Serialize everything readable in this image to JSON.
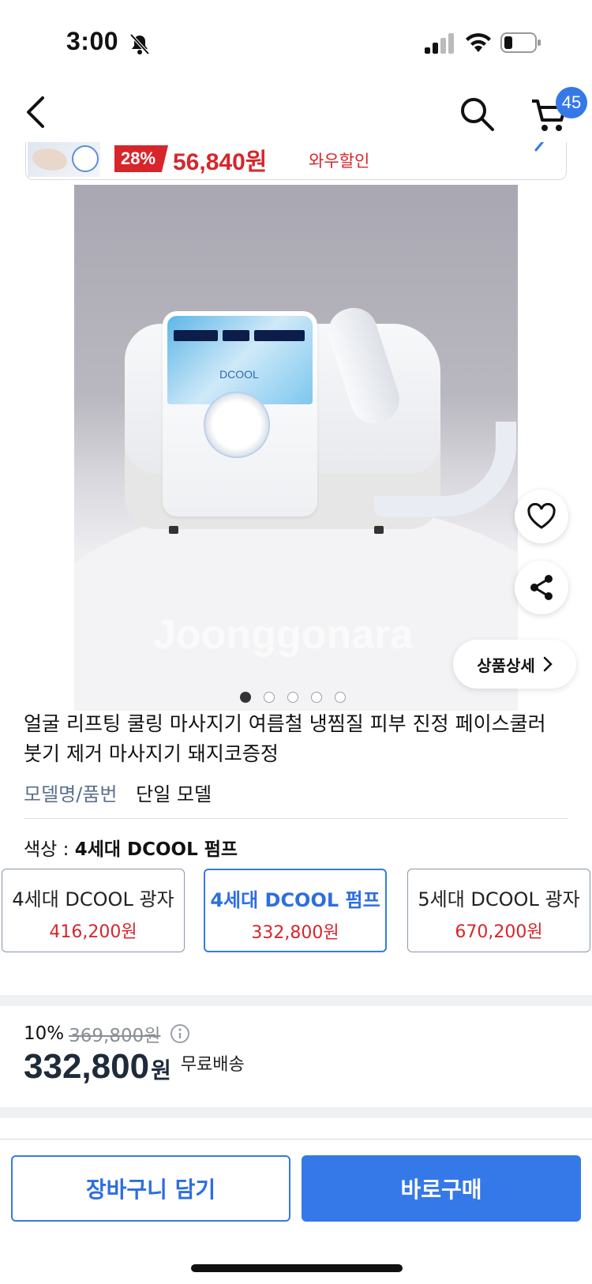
{
  "status_bar": {
    "time": "3:00"
  },
  "nav": {
    "cart_count": "45"
  },
  "price_strip": {
    "discount": "28%",
    "price": "56,840원",
    "label": "와우할인"
  },
  "image": {
    "watermark": "Joonggonara",
    "device_brand": "DCOOL",
    "detail_button": "상품상세",
    "dots_total": 5,
    "dots_active_index": 0
  },
  "product": {
    "title": "얼굴 리프팅 쿨링 마사지기 여름철 냉찜질 피부 진정 페이스쿨러 붓기 제거 마사지기 돼지코증정",
    "model_label": "모델명/품번",
    "model_value": "단일 모델",
    "color_label": "색상 : ",
    "color_value": "4세대 DCOOL 펌프"
  },
  "options": [
    {
      "name": "4세대 DCOOL 광자",
      "price": "416,200원",
      "selected": false
    },
    {
      "name": "4세대 DCOOL 펌프",
      "price": "332,800원",
      "selected": true
    },
    {
      "name": "5세대 DCOOL 광자",
      "price": "670,200원",
      "selected": false
    }
  ],
  "pricing": {
    "discount_rate": "10%",
    "original_price": "369,800원",
    "price": "332,800",
    "unit": "원",
    "shipping": "무료배송"
  },
  "actions": {
    "cart_button": "장바구니 담기",
    "buy_button": "바로구매"
  },
  "colors": {
    "accent": "#3579e8",
    "sale_red": "#d7262b",
    "text_dark": "#1f2a3a"
  }
}
